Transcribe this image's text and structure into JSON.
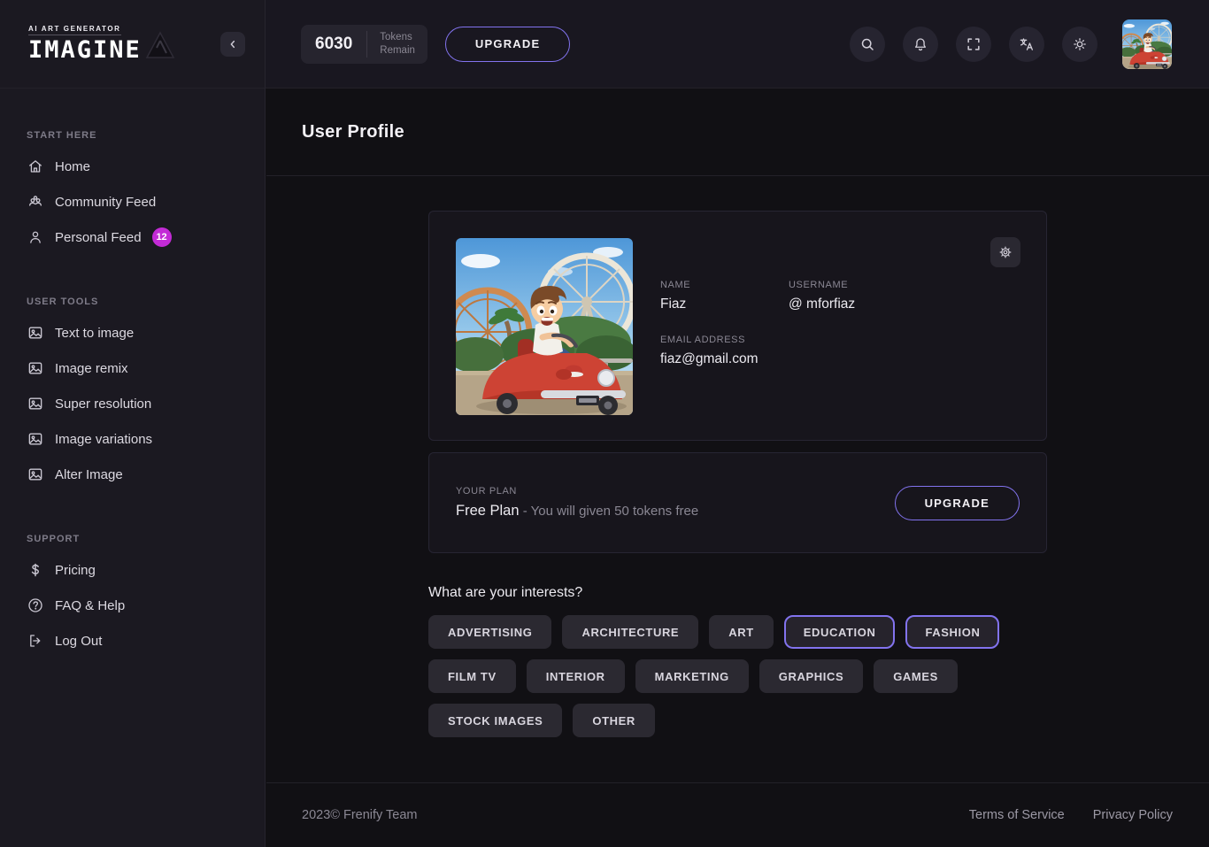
{
  "brand": {
    "tagline": "AI ART GENERATOR",
    "name": "IMAGINE"
  },
  "header": {
    "tokens_value": "6030",
    "tokens_label_line1": "Tokens",
    "tokens_label_line2": "Remain",
    "upgrade_label": "UPGRADE",
    "icon_buttons": [
      {
        "name": "search-button",
        "icon": "search-icon"
      },
      {
        "name": "notifications-button",
        "icon": "bell-icon"
      },
      {
        "name": "fullscreen-button",
        "icon": "fullscreen-icon"
      },
      {
        "name": "translate-button",
        "icon": "translate-icon"
      },
      {
        "name": "brightness-button",
        "icon": "brightness-icon"
      }
    ]
  },
  "sidebar": {
    "sections": [
      {
        "label": "START HERE",
        "items": [
          {
            "label": "Home",
            "icon": "home-icon"
          },
          {
            "label": "Community Feed",
            "icon": "community-icon"
          },
          {
            "label": "Personal Feed",
            "icon": "person-icon",
            "badge": "12"
          }
        ]
      },
      {
        "label": "USER TOOLS",
        "items": [
          {
            "label": "Text to image",
            "icon": "image-icon"
          },
          {
            "label": "Image remix",
            "icon": "image-icon"
          },
          {
            "label": "Super resolution",
            "icon": "image-icon"
          },
          {
            "label": "Image variations",
            "icon": "image-icon"
          },
          {
            "label": "Alter Image",
            "icon": "image-icon"
          }
        ]
      },
      {
        "label": "SUPPORT",
        "items": [
          {
            "label": "Pricing",
            "icon": "dollar-icon"
          },
          {
            "label": "FAQ & Help",
            "icon": "question-icon"
          },
          {
            "label": "Log Out",
            "icon": "logout-icon"
          }
        ]
      }
    ]
  },
  "main": {
    "page_title": "User Profile",
    "profile": {
      "name_label": "NAME",
      "name": "Fiaz",
      "username_label": "USERNAME",
      "username": "@ mforfiaz",
      "email_label": "EMAIL ADDRESS",
      "email": "fiaz@gmail.com"
    },
    "plan": {
      "label": "YOUR PLAN",
      "plan_name": "Free Plan",
      "plan_desc": " - You will given 50 tokens free",
      "upgrade_label": "UPGRADE"
    },
    "interests": {
      "question": "What are your interests?",
      "rows": [
        [
          {
            "label": "ADVERTISING",
            "selected": false
          },
          {
            "label": "ARCHITECTURE",
            "selected": false
          },
          {
            "label": "ART",
            "selected": false
          },
          {
            "label": "EDUCATION",
            "selected": true
          },
          {
            "label": "FASHION",
            "selected": true
          }
        ],
        [
          {
            "label": "FILM TV",
            "selected": false
          },
          {
            "label": "INTERIOR",
            "selected": false
          },
          {
            "label": "MARKETING",
            "selected": false
          },
          {
            "label": "GRAPHICS",
            "selected": false
          },
          {
            "label": "GAMES",
            "selected": false
          }
        ],
        [
          {
            "label": "STOCK IMAGES",
            "selected": false
          },
          {
            "label": "OTHER",
            "selected": false
          }
        ]
      ]
    }
  },
  "footer": {
    "copyright": "2023© Frenify Team",
    "links": [
      "Terms of Service",
      "Privacy Policy"
    ]
  },
  "colors": {
    "accent_purple": "#8273ee",
    "badge_magenta": "#c32bd6"
  }
}
